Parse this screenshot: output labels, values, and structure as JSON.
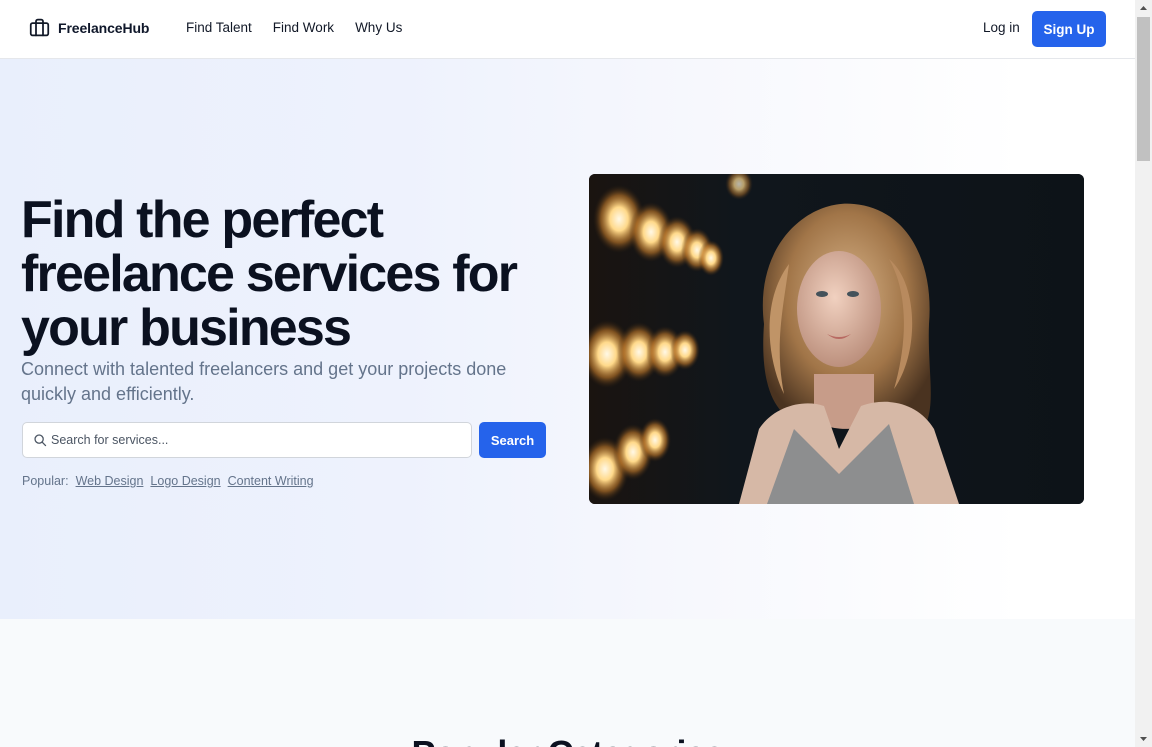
{
  "nav": {
    "brand": "FreelanceHub",
    "links": [
      "Find Talent",
      "Find Work",
      "Why Us"
    ],
    "login": "Log in",
    "signup": "Sign Up"
  },
  "hero": {
    "headline": "Find the perfect freelance services for your business",
    "subhead": "Connect with talented freelancers and get your projects done quickly and efficiently.",
    "search_placeholder": "Search for services...",
    "search_button": "Search",
    "popular_label": "Popular:",
    "popular_tags": [
      "Web Design",
      "Logo Design",
      "Content Writing"
    ]
  },
  "section": {
    "title": "Popular Categories"
  },
  "colors": {
    "accent": "#2563eb",
    "headline": "#0b1120",
    "muted": "#64748b"
  },
  "icons": {
    "brand": "briefcase-icon",
    "search": "search-icon"
  }
}
